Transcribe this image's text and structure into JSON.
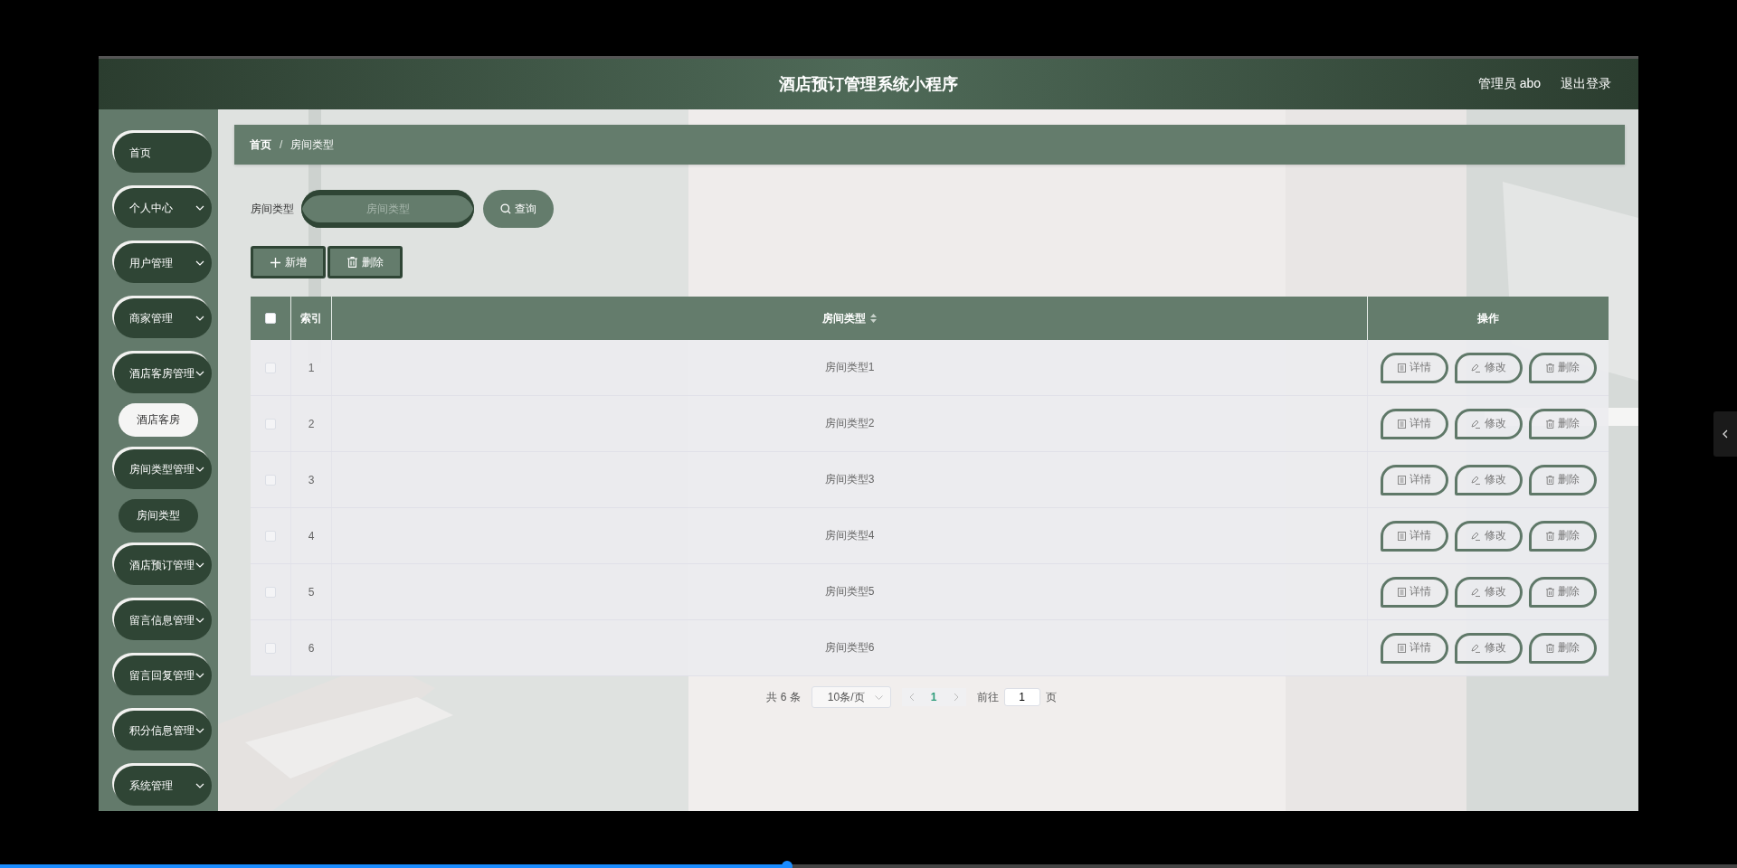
{
  "header": {
    "title": "酒店预订管理系统小程序",
    "user": "管理员 abo",
    "logout": "退出登录"
  },
  "sidebar": {
    "items": [
      {
        "label": "首页",
        "kind": "link"
      },
      {
        "label": "个人中心",
        "kind": "menu"
      },
      {
        "label": "用户管理",
        "kind": "menu"
      },
      {
        "label": "商家管理",
        "kind": "menu"
      },
      {
        "label": "酒店客房管理",
        "kind": "menu",
        "children": [
          {
            "label": "酒店客房",
            "selected": false
          }
        ]
      },
      {
        "label": "房间类型管理",
        "kind": "menu",
        "children": [
          {
            "label": "房间类型",
            "selected": true
          }
        ]
      },
      {
        "label": "酒店预订管理",
        "kind": "menu"
      },
      {
        "label": "留言信息管理",
        "kind": "menu"
      },
      {
        "label": "留言回复管理",
        "kind": "menu"
      },
      {
        "label": "积分信息管理",
        "kind": "menu"
      },
      {
        "label": "系统管理",
        "kind": "menu"
      }
    ]
  },
  "breadcrumb": [
    "首页",
    "/",
    "房间类型"
  ],
  "search": {
    "label": "房间类型",
    "placeholder": "房间类型",
    "button": "查询"
  },
  "toolbar": [
    "新增",
    "删除"
  ],
  "table": {
    "all_checked": false,
    "columns": [
      "索引",
      "房间类型",
      "操作"
    ],
    "rows": [
      {
        "checked": false,
        "index": "1",
        "name": "房间类型1",
        "actions": [
          "详情",
          "修改",
          "删除"
        ]
      },
      {
        "checked": false,
        "index": "2",
        "name": "房间类型2",
        "actions": [
          "详情",
          "修改",
          "删除"
        ]
      },
      {
        "checked": false,
        "index": "3",
        "name": "房间类型3",
        "actions": [
          "详情",
          "修改",
          "删除"
        ]
      },
      {
        "checked": false,
        "index": "4",
        "name": "房间类型4",
        "actions": [
          "详情",
          "修改",
          "删除"
        ]
      },
      {
        "checked": false,
        "index": "5",
        "name": "房间类型5",
        "actions": [
          "详情",
          "修改",
          "删除"
        ]
      },
      {
        "checked": false,
        "index": "6",
        "name": "房间类型6",
        "actions": [
          "详情",
          "修改",
          "删除"
        ]
      }
    ]
  },
  "pagination": {
    "total": "共 6 条",
    "page_size": "10条/页",
    "pages": [
      {
        "label": "1",
        "selected": true
      }
    ],
    "goto_label": "前往",
    "goto_value": "1",
    "goto_suffix": "页"
  },
  "player": {
    "level": 0.453
  }
}
